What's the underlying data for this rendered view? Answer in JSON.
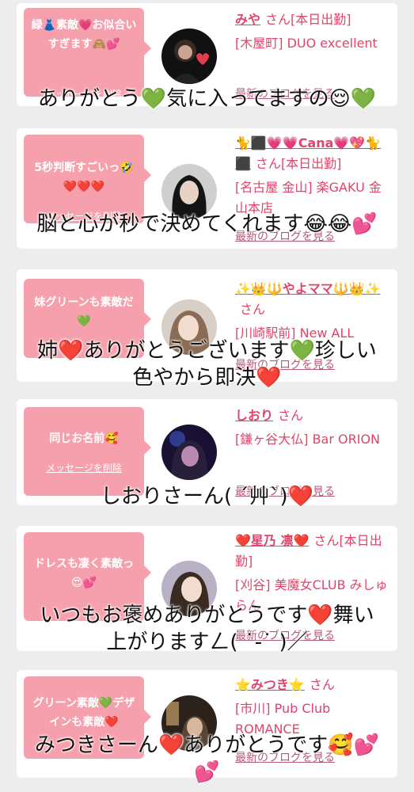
{
  "delete_label": "メッセージを削除",
  "blog_label": "最新のブログを見る",
  "honorific": "さん",
  "entries": [
    {
      "message": "緑👗素敵💗お似合いすぎます🙈💕",
      "name": "みや",
      "status": "[本日出勤]",
      "shop": "[木屋町] DUO excellent",
      "reply": "ありがとう💚気に入ってますの😌💚"
    },
    {
      "message": "5秒判断すごいっ🤣❤️❤️❤️",
      "name": "🐈⬛💗💗Cana💗💖🐈⬛",
      "status": "[本日出勤]",
      "shop": "[名古屋 金山] 楽GAKU 金山本店",
      "reply": "脳と心が秒で決めてくれます😂😂💕"
    },
    {
      "message": "妹グリーンも素敵だ💚",
      "name": "✨👑🔱やよママ🔱👑✨",
      "status": "",
      "shop": "[川崎駅前] New ALL",
      "reply": "姉❤️ありがとうございます💚珍しい\n色やから即決❤️"
    },
    {
      "message": "同じお名前🥰",
      "name": "しおり",
      "status": "",
      "shop": "[鎌ヶ谷大仏] Bar ORION",
      "reply": "しおりさーん( ˊ艸ˋ)❤️"
    },
    {
      "message": "ドレスも凄く素敵っ😍💕",
      "name": "❤️星乃 凛❤️",
      "status": "[本日出勤]",
      "shop": "[刈谷] 美魔女CLUB みしゅらん",
      "reply": "いつもお褒めありがとうです❤️舞い\n上がりますㄥ( ˙-˙ )／"
    },
    {
      "message": "グリーン素敵💚デザインも素敵❤️",
      "name": "⭐️みつき⭐️",
      "status": "",
      "shop": "[市川] Pub Club ROMANCE",
      "reply": "みつきさーん❤️ありがとうです🥰💕\n💕"
    }
  ]
}
